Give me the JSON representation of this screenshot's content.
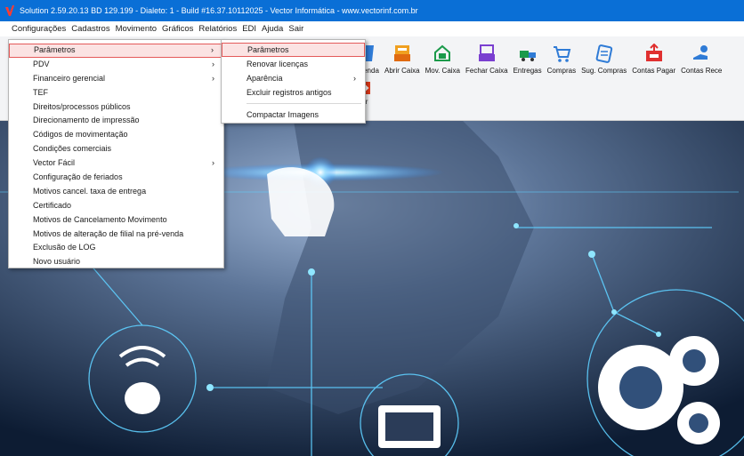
{
  "window": {
    "title": "Solution 2.59.20.13 BD 129.199 - Dialeto: 1 - Build #16.37.10112025  - Vector Informática - www.vectorinf.com.br"
  },
  "menubar": {
    "items": [
      "Configurações",
      "Cadastros",
      "Movimento",
      "Gráficos",
      "Relatórios",
      "EDI",
      "Ajuda",
      "Sair"
    ]
  },
  "toolbar": {
    "buttons": [
      {
        "label": "venda",
        "icon": "sale-icon"
      },
      {
        "label": "Abrir Caixa",
        "icon": "open-cash-icon"
      },
      {
        "label": "Mov. Caixa",
        "icon": "cash-movement-icon"
      },
      {
        "label": "Fechar Caixa",
        "icon": "close-cash-icon"
      },
      {
        "label": "Entregas",
        "icon": "delivery-icon"
      },
      {
        "label": "Compras",
        "icon": "cart-icon"
      },
      {
        "label": "Sug. Compras",
        "icon": "purchase-suggestion-icon"
      },
      {
        "label": "Contas Pagar",
        "icon": "accounts-payable-icon"
      },
      {
        "label": "Contas Rece",
        "icon": "accounts-receivable-icon"
      }
    ],
    "exit_label": "air"
  },
  "config_menu": {
    "items": [
      {
        "label": "Parâmetros",
        "submenu": true,
        "selected": true
      },
      {
        "label": "PDV",
        "submenu": true
      },
      {
        "label": "Financeiro gerencial",
        "submenu": true
      },
      {
        "label": "TEF"
      },
      {
        "label": "Direitos/processos públicos"
      },
      {
        "label": "Direcionamento de impressão"
      },
      {
        "label": "Códigos de movimentação"
      },
      {
        "label": "Condições comerciais"
      },
      {
        "label": "Vector Fácil",
        "submenu": true
      },
      {
        "label": "Configuração de feriados"
      },
      {
        "label": "Motivos cancel. taxa de entrega"
      },
      {
        "label": "Certificado"
      },
      {
        "label": "Motivos de Cancelamento Movimento"
      },
      {
        "label": "Motivos de alteração de filial na pré-venda"
      },
      {
        "label": "Exclusão de LOG"
      },
      {
        "label": "Novo usuário"
      }
    ]
  },
  "params_submenu": {
    "items": [
      {
        "label": "Parâmetros",
        "selected": true
      },
      {
        "label": "Renovar licenças"
      },
      {
        "label": "Aparência",
        "submenu": true
      },
      {
        "label": "Excluir registros antigos"
      },
      {
        "label": "Compactar Imagens"
      }
    ]
  },
  "colors": {
    "titlebar": "#0a6fd6",
    "selection_border": "#e45a5a",
    "selection_fill": "#fbe3e3"
  }
}
